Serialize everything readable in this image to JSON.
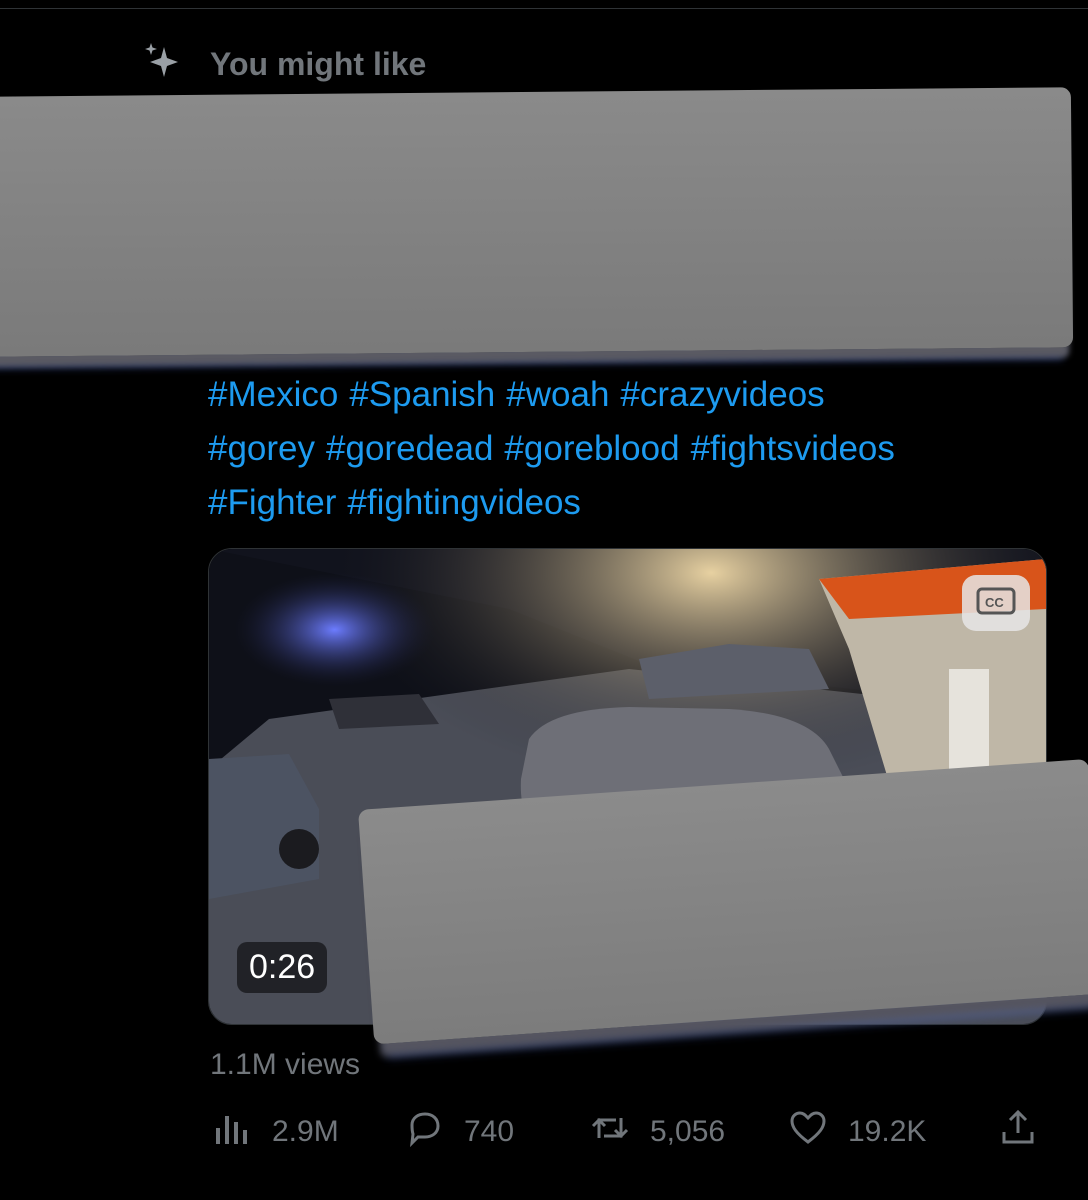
{
  "recommendation": {
    "title": "You might like",
    "icon": "sparkle-icon"
  },
  "tweet": {
    "hashtags": [
      "#Mexico",
      "#Spanish",
      "#woah",
      "#crazyvideos",
      "#gorey",
      "#goredead",
      "#goreblood",
      "#fightsvideos",
      "#Fighter",
      "#fightingvideos"
    ],
    "video": {
      "duration": "0:26",
      "cc_icon": "closed-captions-icon"
    },
    "views_label": "1.1M views"
  },
  "actions": {
    "analytics": "2.9M",
    "replies": "740",
    "retweets": "5,056",
    "likes": "19.2K"
  },
  "colors": {
    "background": "#000000",
    "link": "#1d9bf0",
    "muted": "#71767b",
    "redaction": "#808080"
  }
}
